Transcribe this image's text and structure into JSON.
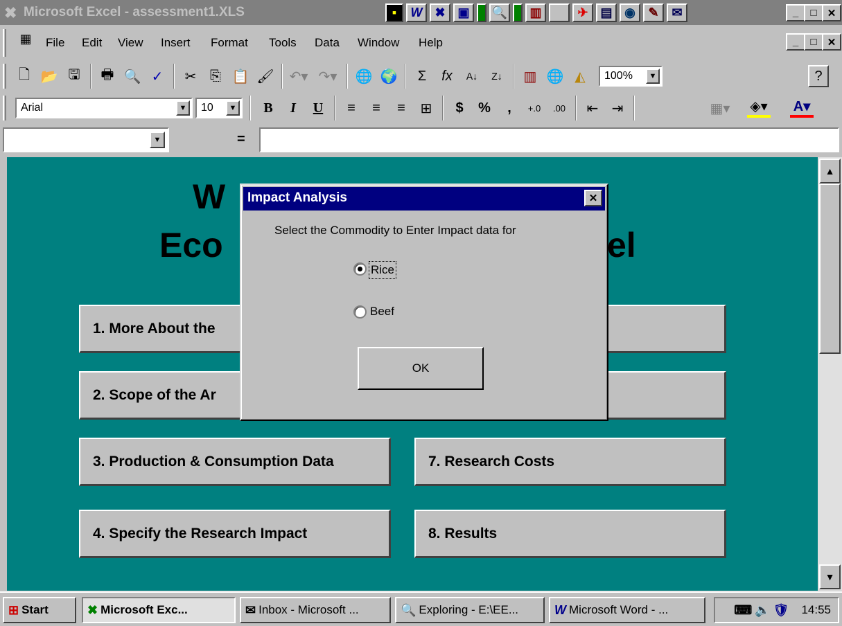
{
  "window": {
    "title": "Microsoft Excel - assessment1.XLS",
    "min": "_",
    "max": "□",
    "close": "✕"
  },
  "menu": {
    "items": [
      "File",
      "Edit",
      "View",
      "Insert",
      "Format",
      "Tools",
      "Data",
      "Window",
      "Help"
    ]
  },
  "toolbar": {
    "zoom": "100%"
  },
  "format_bar": {
    "font": "Arial",
    "size": "10",
    "bold": "B",
    "italic": "I",
    "underline": "U",
    "currency": "$",
    "percent": "%",
    "comma": ","
  },
  "formula_bar": {
    "name_box": "",
    "equals": "="
  },
  "sheet": {
    "title_line1_left": "W",
    "title_line2_left": "Eco",
    "title_line2_right": "el",
    "buttons": [
      "1. More About the",
      "2. Scope of the Ar",
      "3. Production & Consumption Data",
      "4. Specify the Research Impact",
      "7. Research Costs",
      "8. Results"
    ]
  },
  "dialog": {
    "title": "Impact Analysis",
    "prompt": "Select the Commodity to Enter Impact data for",
    "options": [
      {
        "label": "Rice",
        "selected": true
      },
      {
        "label": "Beef",
        "selected": false
      }
    ],
    "ok": "OK",
    "close": "✕"
  },
  "taskbar": {
    "start": "Start",
    "tasks": [
      "Microsoft Exc...",
      "Inbox - Microsoft ...",
      "Exploring - E:\\EE...",
      "Microsoft Word - ..."
    ],
    "clock": "14:55"
  },
  "colors": {
    "sheet_bg": "#008080",
    "dialog_title_bg": "#000080",
    "inactive_title_bg": "#808080"
  }
}
